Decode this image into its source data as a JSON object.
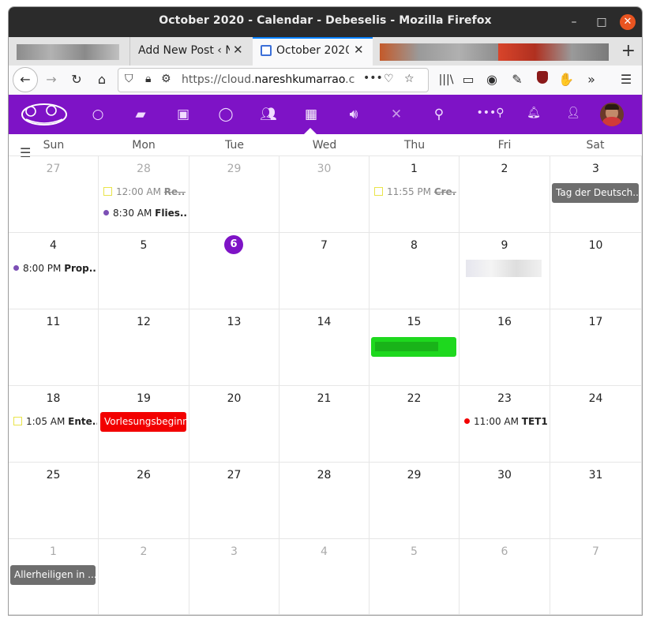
{
  "window": {
    "title": "October 2020 - Calendar - Debeselis - Mozilla Firefox",
    "minimize": "–",
    "maximize": "□",
    "close": "✕"
  },
  "tabs": [
    {
      "label": "Add New Post ‹ N",
      "close": "✕"
    },
    {
      "label": "October 2020 -",
      "close": "✕"
    }
  ],
  "nav": {
    "url_prefix": "https://cloud.",
    "url_domain": "nareshkumarrao",
    "url_suffix": ".c",
    "more": "•••",
    "overflow": "»",
    "menu": "☰"
  },
  "nextcloud": {
    "apps": [
      "dashboard-icon",
      "files-icon",
      "photos-icon",
      "talk-icon",
      "contacts-icon",
      "calendar-icon",
      "audio-icon",
      "deck-icon",
      "maps-icon",
      "more-apps-icon",
      "notifications-icon",
      "contacts-menu-icon"
    ]
  },
  "calendar": {
    "weekdays": [
      "Sun",
      "Mon",
      "Tue",
      "Wed",
      "Thu",
      "Fri",
      "Sat"
    ],
    "weeks": [
      [
        "27",
        "28",
        "29",
        "30",
        "1",
        "2",
        "3"
      ],
      [
        "4",
        "5",
        "6",
        "7",
        "8",
        "9",
        "10"
      ],
      [
        "11",
        "12",
        "13",
        "14",
        "15",
        "16",
        "17"
      ],
      [
        "18",
        "19",
        "20",
        "21",
        "22",
        "23",
        "24"
      ],
      [
        "25",
        "26",
        "27",
        "28",
        "29",
        "30",
        "31"
      ],
      [
        "1",
        "2",
        "3",
        "4",
        "5",
        "6",
        "7"
      ]
    ],
    "today": "6",
    "events": {
      "sep28_task_time": "12:00 AM",
      "sep28_task_title": "Re...",
      "sep28_event_time": "8:30 AM",
      "sep28_event_title": "Flies...",
      "oct1_task_time": "11:55 PM",
      "oct1_task_title": "Cre...",
      "oct3_allday": "Tag der Deutsch...",
      "oct4_event_time": "8:00 PM",
      "oct4_event_title": "Prop...",
      "oct18_task_time": "1:05 AM",
      "oct18_task_title": "Ente...",
      "oct19_allday": "Vorlesungsbeginn",
      "oct23_event_time": "11:00 AM",
      "oct23_event_title": "TET1",
      "nov1_allday": "Allerheiligen in ..."
    },
    "colors": {
      "accent": "#7e13c6",
      "gray_event": "#6e6e6e",
      "red_event": "#f20000",
      "green_event": "#1ed81e",
      "task_border": "#e9e44a"
    }
  }
}
